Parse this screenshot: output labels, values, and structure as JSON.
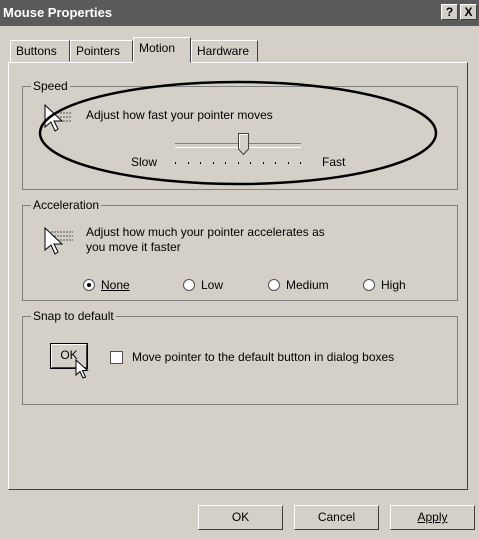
{
  "window": {
    "title": "Mouse Properties",
    "help_label": "?",
    "close_label": "X"
  },
  "tabs": [
    {
      "label": "Buttons",
      "active": false
    },
    {
      "label": "Pointers",
      "active": false
    },
    {
      "label": "Motion",
      "active": true
    },
    {
      "label": "Hardware",
      "active": false
    }
  ],
  "speed": {
    "group_label": "Speed",
    "description": "Adjust how fast your pointer moves",
    "slow_label": "Slow",
    "fast_label": "Fast",
    "slider_value": 0.55,
    "icon": "pointer-speed-icon"
  },
  "acceleration": {
    "group_label": "Acceleration",
    "description_line1": "Adjust how much your pointer accelerates as",
    "description_line2": "you move it faster",
    "options": [
      {
        "label": "None",
        "selected": true
      },
      {
        "label": "Low",
        "selected": false
      },
      {
        "label": "Medium",
        "selected": false
      },
      {
        "label": "High",
        "selected": false
      }
    ],
    "icon": "pointer-acceleration-icon"
  },
  "snap": {
    "group_label": "Snap to default",
    "button_label": "OK",
    "checkbox_label": "Move pointer to the default button in dialog boxes",
    "checked": false
  },
  "footer": {
    "ok_label": "OK",
    "cancel_label": "Cancel",
    "apply_label": "Apply"
  }
}
